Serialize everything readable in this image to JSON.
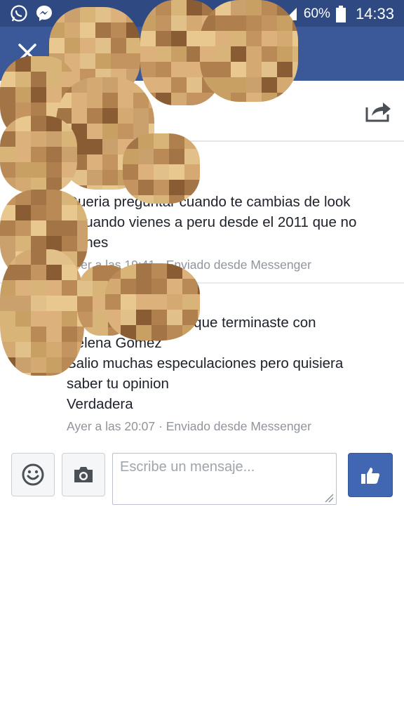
{
  "status_bar": {
    "battery": "60%",
    "time": "14:33",
    "icons": [
      "whatsapp-icon",
      "messenger-icon",
      "signal-icon",
      "battery-icon"
    ]
  },
  "header": {
    "close_icon": "close-icon"
  },
  "subheader": {
    "share_icon": "share-icon"
  },
  "messages": [
    {
      "lines": [
        "Queria preguntar cuando te cambias de look",
        "y cuando vienes a peru desde el 2011 que no",
        "vienes"
      ],
      "meta": "Ayer a las 19:41 · Enviado desde Messenger"
    },
    {
      "lines": [
        "Queria saber la por que terminaste con",
        "Selena Gomez",
        "Salio muchas especulaciones pero quisiera",
        "saber tu opinion",
        "Verdadera"
      ],
      "meta": "Ayer a las 20:07 · Enviado desde Messenger"
    }
  ],
  "composer": {
    "placeholder": "Escribe un mensaje...",
    "emoji_icon": "smiley-icon",
    "camera_icon": "camera-icon",
    "like_icon": "thumbs-up-icon"
  },
  "colors": {
    "header": "#3b5998",
    "status_bar": "#2f4a82",
    "like_button": "#4267b2"
  }
}
